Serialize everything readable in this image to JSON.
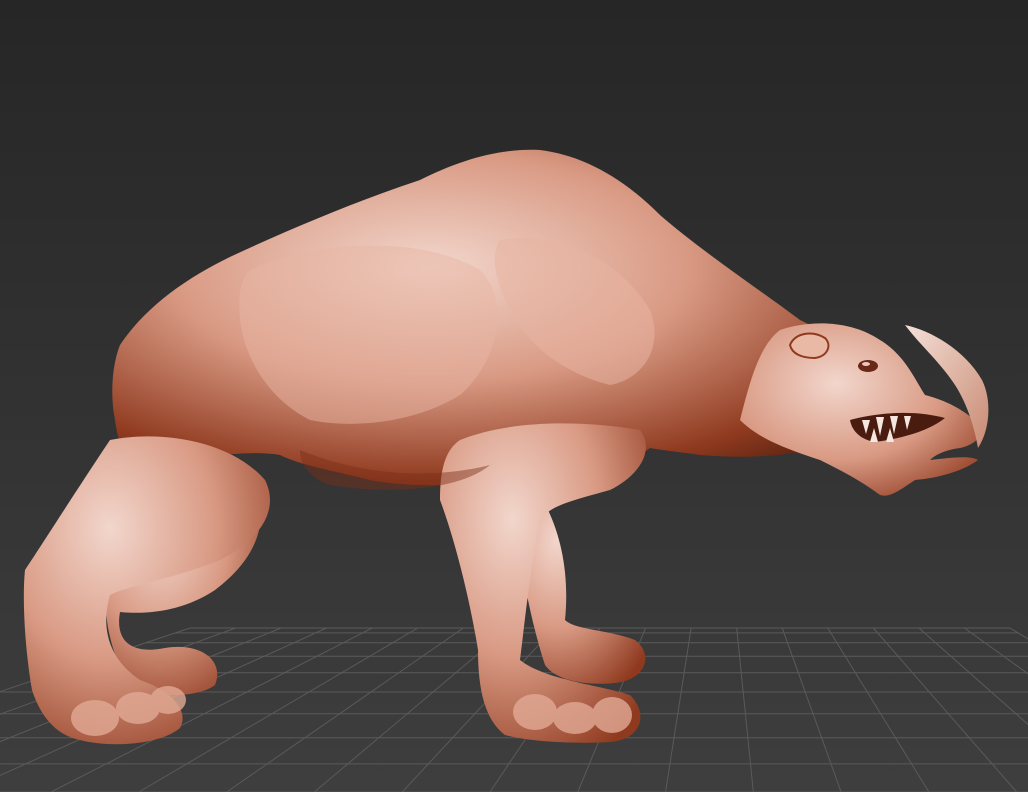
{
  "viewport": {
    "background_top": "#262626",
    "background_bottom": "#3e3e3e",
    "grid_color": "#5a5a5a",
    "grid_visible": true
  },
  "model": {
    "material_light": "#f2d6cc",
    "material_mid": "#d99a84",
    "material_dark": "#8f3a1f",
    "material_shadow": "#5e2412"
  }
}
